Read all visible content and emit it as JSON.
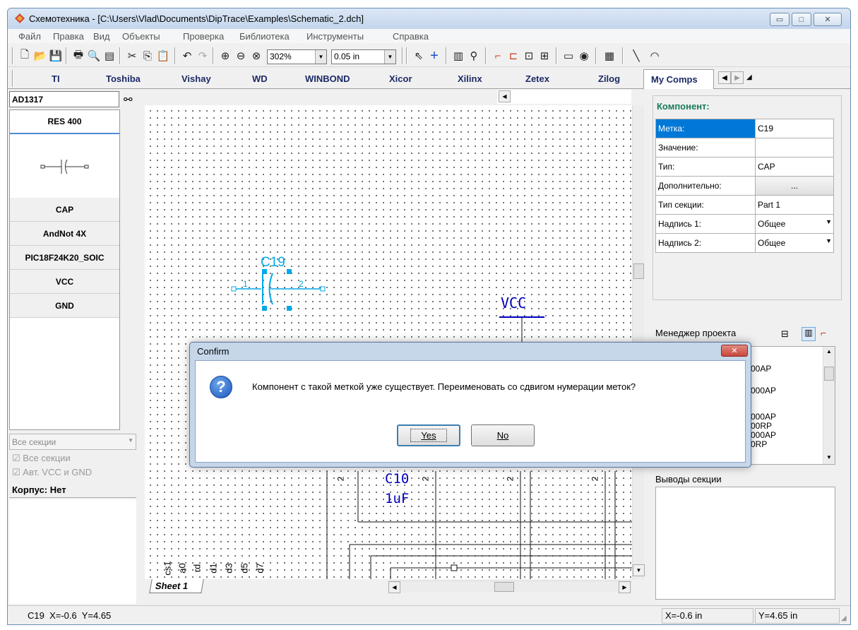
{
  "window": {
    "title": "Схемотехника - [C:\\Users\\Vlad\\Documents\\DipTrace\\Examples\\Schematic_2.dch]",
    "icon": "diptrace-icon"
  },
  "menu": [
    "Файл",
    "Правка",
    "Вид",
    "Объекты",
    "Проверка",
    "Библиотека",
    "Инструменты",
    "Справка"
  ],
  "toolbar": {
    "zoom_value": "302%",
    "grid_value": "0.05 in"
  },
  "library_tabs": [
    "TI",
    "Toshiba",
    "Vishay",
    "WD",
    "WINBOND",
    "Xicor",
    "Xilinx",
    "Zetex",
    "Zilog",
    "My Comps"
  ],
  "left_panel": {
    "search_value": "AD1317",
    "components": [
      "RES 400",
      "CAP",
      "AndNot 4X",
      "PIC18F24K20_SOIC",
      "VCC",
      "GND"
    ],
    "sections_select": "Все секции",
    "check_all_sections": "Все секции",
    "check_auto_vcc": "Авт. VCC и GND",
    "package_label": "Корпус: Нет"
  },
  "right_panel": {
    "component_header": "Компонент:",
    "properties": [
      {
        "label": "Метка:",
        "value": "C19"
      },
      {
        "label": "Значение:",
        "value": ""
      },
      {
        "label": "Тип:",
        "value": "CAP"
      },
      {
        "label": "Дополнительно:",
        "value": "..."
      },
      {
        "label": "Тип секции:",
        "value": "Part 1"
      },
      {
        "label": "Надпись 1:",
        "value": "Общее"
      },
      {
        "label": "Надпись 2:",
        "value": "Общее"
      }
    ],
    "project_manager": "Менеджер проекта",
    "project_items": [
      "00AP",
      "000AP",
      "000AP",
      "00RP",
      "000AP",
      "0RP"
    ],
    "section_pins": "Выводы секции"
  },
  "canvas": {
    "cap_label": "C19",
    "cap_pin1": "1",
    "cap_pin2": "2",
    "vcc_label": "VCC",
    "c10_label": "C10",
    "c10_value": "1uF",
    "pin_marks": [
      "2",
      "2",
      "2",
      "2"
    ],
    "net_labels": [
      "cs1",
      "a0",
      "rd",
      "d1",
      "d3",
      "d5",
      "d7"
    ],
    "sheet_tab": "Sheet 1"
  },
  "dialog": {
    "title": "Confirm",
    "message": "Компонент с такой меткой уже существует. Переименовать со сдвигом нумерации меток?",
    "yes": "Yes",
    "no": "No"
  },
  "status": {
    "left": "C19  X=-0.6  Y=4.65",
    "x": "X=-0.6 in",
    "y": "Y=4.65 in"
  },
  "colors": {
    "accent": "#0078d7",
    "component_cyan": "#00a8e8",
    "net_blue": "#0000c0",
    "header_green": "#1a7a5a",
    "dialog_close": "#c9463d"
  }
}
